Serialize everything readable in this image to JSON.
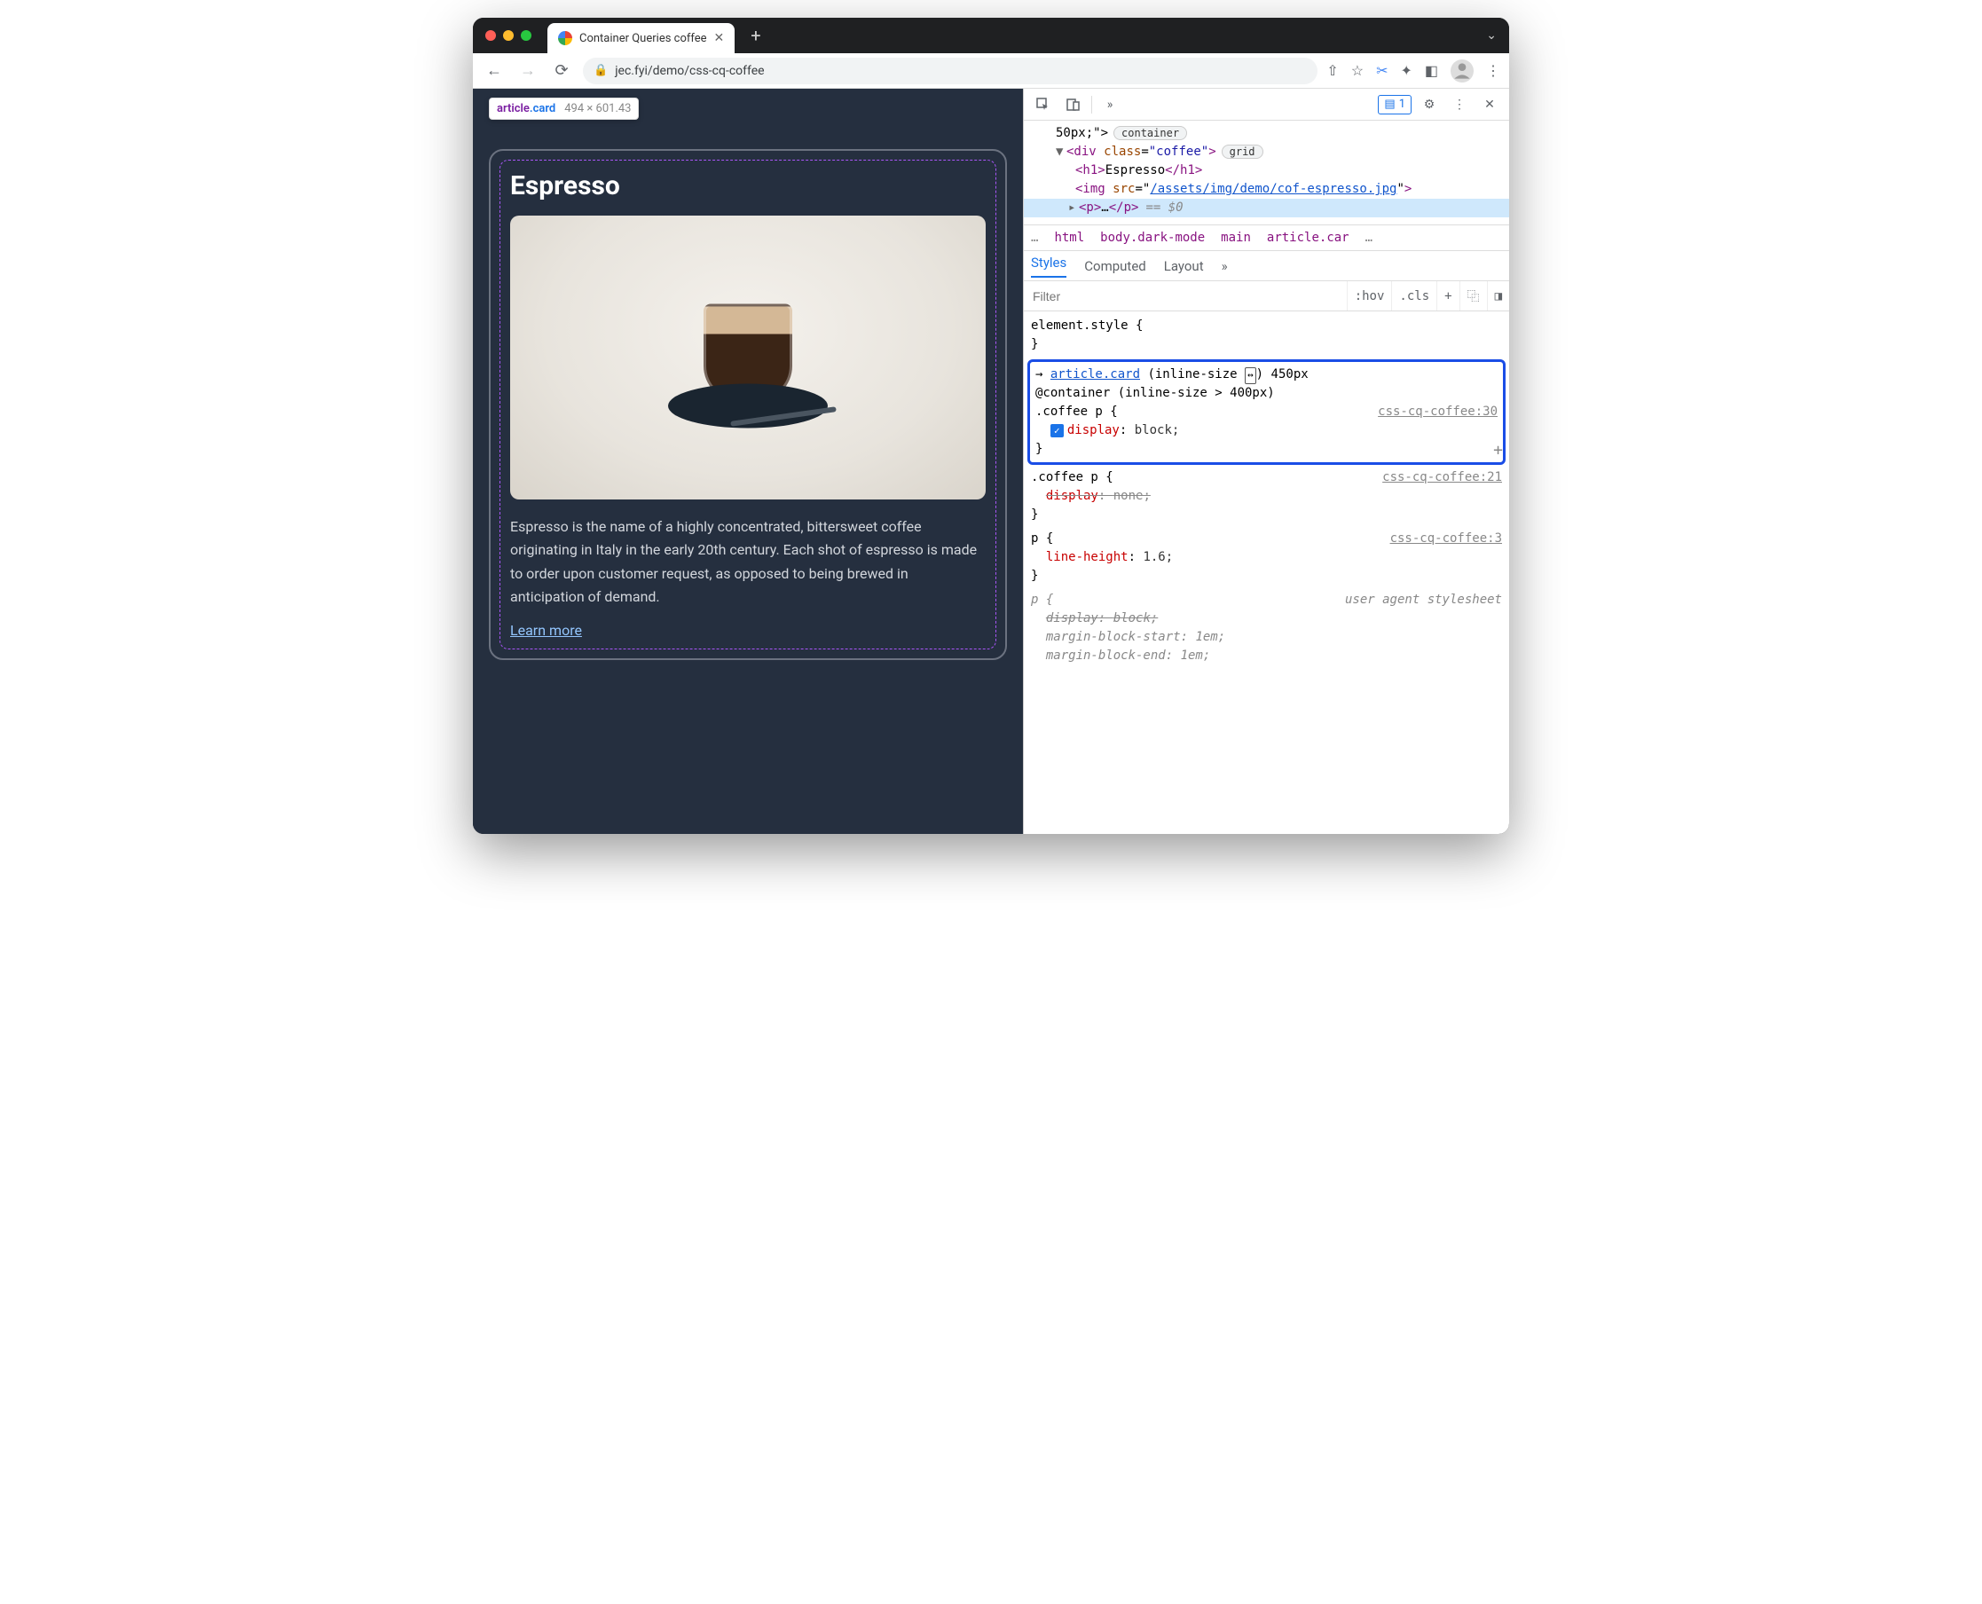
{
  "browser": {
    "tab_title": "Container Queries coffee",
    "url": "jec.fyi/demo/css-cq-coffee"
  },
  "inspect_tooltip": {
    "selector_tag": "article",
    "selector_class": ".card",
    "dimensions": "494 × 601.43"
  },
  "page": {
    "heading": "Espresso",
    "paragraph": "Espresso is the name of a highly concentrated, bittersweet coffee originating in Italy in the early 20th century. Each shot of espresso is made to order upon customer request, as opposed to being brewed in anticipation of demand.",
    "link_text": "Learn more"
  },
  "devtools": {
    "issues_count": "1",
    "dom": {
      "line0": "50px;\">",
      "badge1": "container",
      "div_open": "<div class=\"coffee\">",
      "badge2": "grid",
      "h1_open": "<h1>",
      "h1_text": "Espresso",
      "h1_close": "</h1>",
      "img_prefix": "<img src=\"",
      "img_src": "/assets/img/demo/cof-espresso.jpg",
      "img_suffix": "\">",
      "p_collapsed": "<p>…</p>",
      "eq0": "== $0"
    },
    "crumbs": [
      "html",
      "body.dark-mode",
      "main",
      "article.car"
    ],
    "styles_tabs": [
      "Styles",
      "Computed",
      "Layout"
    ],
    "filter_placeholder": "Filter",
    "hov": ":hov",
    "cls": ".cls",
    "rules": {
      "element_style": "element.style {",
      "cq": {
        "arrow_sel": "article.card",
        "size_label": "(inline-size",
        "size_val": "450px",
        "at": "@container (inline-size > 400px)",
        "sel": ".coffee p {",
        "src": "css-cq-coffee:30",
        "prop": "display",
        "val": "block;"
      },
      "r2": {
        "sel": ".coffee p {",
        "src": "css-cq-coffee:21",
        "prop": "display",
        "val": "none;"
      },
      "r3": {
        "sel": "p {",
        "src": "css-cq-coffee:3",
        "prop": "line-height",
        "val": "1.6;"
      },
      "r4": {
        "sel": "p {",
        "src": "user agent stylesheet",
        "p1": "display",
        "v1": "block;",
        "p2": "margin-block-start",
        "v2": "1em;",
        "p3": "margin-block-end",
        "v3": "1em;"
      }
    }
  }
}
